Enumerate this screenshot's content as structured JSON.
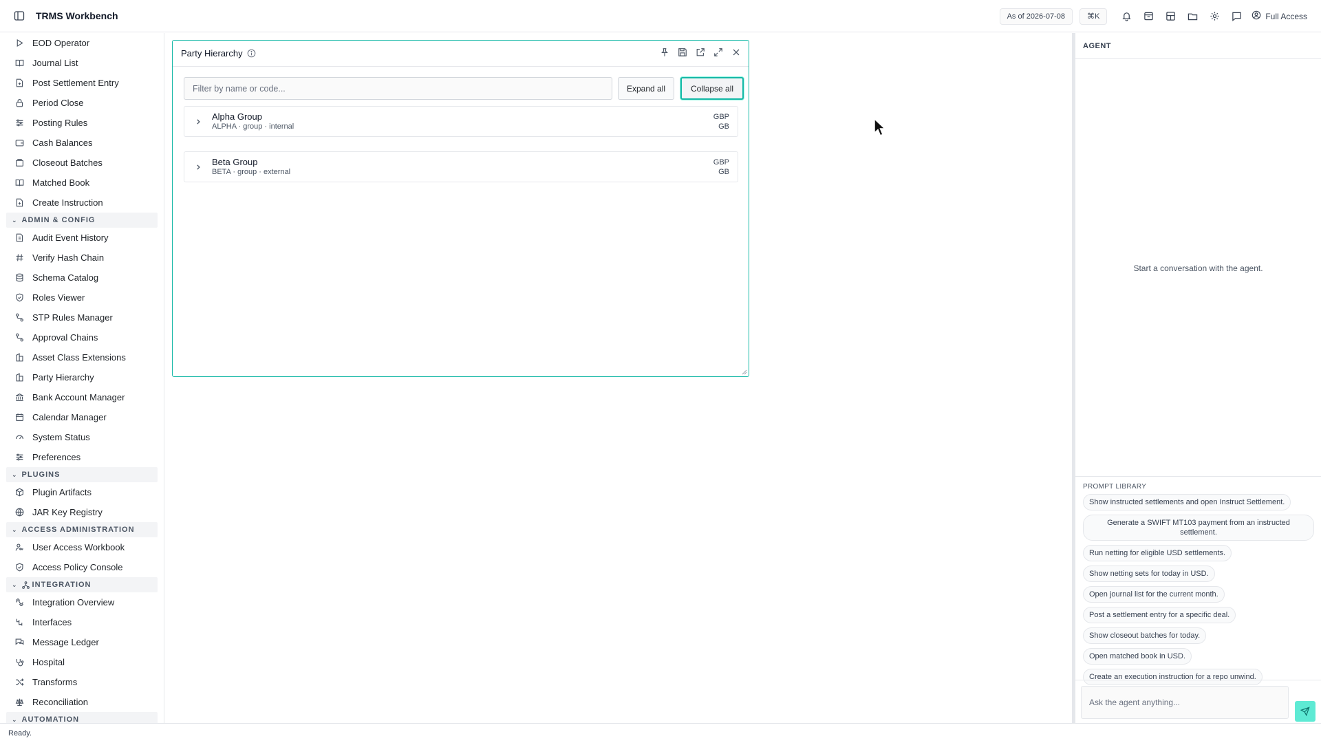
{
  "app": {
    "title": "TRMS Workbench"
  },
  "topbar": {
    "as_of": "As of 2026-07-08",
    "shortcut": "⌘K",
    "access_label": "Full Access",
    "icons": [
      "bell-icon",
      "archive-icon",
      "layout-icon",
      "folder-icon",
      "gear-icon",
      "chat-icon",
      "user-circle-icon"
    ]
  },
  "sidebar": {
    "items_top": [
      {
        "label": "EOD Operator",
        "icon": "play-icon"
      },
      {
        "label": "Journal List",
        "icon": "book-icon"
      },
      {
        "label": "Post Settlement Entry",
        "icon": "document-plus-icon"
      },
      {
        "label": "Period Close",
        "icon": "lock-icon"
      },
      {
        "label": "Posting Rules",
        "icon": "sliders-icon"
      },
      {
        "label": "Cash Balances",
        "icon": "wallet-icon"
      },
      {
        "label": "Closeout Batches",
        "icon": "batch-icon"
      },
      {
        "label": "Matched Book",
        "icon": "book-icon"
      },
      {
        "label": "Create Instruction",
        "icon": "document-plus-icon"
      }
    ],
    "admin_section": {
      "label": "ADMIN & CONFIG"
    },
    "items_admin": [
      {
        "label": "Audit Event History",
        "icon": "history-icon"
      },
      {
        "label": "Verify Hash Chain",
        "icon": "hash-icon"
      },
      {
        "label": "Schema Catalog",
        "icon": "database-icon"
      },
      {
        "label": "Roles Viewer",
        "icon": "shield-icon"
      },
      {
        "label": "STP Rules Manager",
        "icon": "route-icon"
      },
      {
        "label": "Approval Chains",
        "icon": "route-icon"
      },
      {
        "label": "Asset Class Extensions",
        "icon": "building-icon"
      },
      {
        "label": "Party Hierarchy",
        "icon": "building-icon"
      },
      {
        "label": "Bank Account Manager",
        "icon": "bank-icon"
      },
      {
        "label": "Calendar Manager",
        "icon": "calendar-icon"
      },
      {
        "label": "System Status",
        "icon": "gauge-icon"
      },
      {
        "label": "Preferences",
        "icon": "sliders-icon"
      }
    ],
    "plugins_section": {
      "label": "PLUGINS"
    },
    "items_plugins": [
      {
        "label": "Plugin Artifacts",
        "icon": "package-icon"
      },
      {
        "label": "JAR Key Registry",
        "icon": "globe-icon"
      }
    ],
    "access_section": {
      "label": "ACCESS ADMINISTRATION"
    },
    "items_access": [
      {
        "label": "User Access Workbook",
        "icon": "user-key-icon"
      },
      {
        "label": "Access Policy Console",
        "icon": "shield-icon"
      }
    ],
    "integration_section": {
      "label": "INTEGRATION"
    },
    "items_integration": [
      {
        "label": "Integration Overview",
        "icon": "integration-icon"
      },
      {
        "label": "Interfaces",
        "icon": "interfaces-icon"
      },
      {
        "label": "Message Ledger",
        "icon": "messages-icon"
      },
      {
        "label": "Hospital",
        "icon": "hospital-icon"
      },
      {
        "label": "Transforms",
        "icon": "shuffle-icon"
      },
      {
        "label": "Reconciliation",
        "icon": "scale-icon"
      }
    ],
    "automation_section": {
      "label": "AUTOMATION"
    }
  },
  "panel": {
    "title": "Party Hierarchy",
    "filter_placeholder": "Filter by name or code...",
    "filter_value": "",
    "expand_all": "Expand all",
    "collapse_all": "Collapse all",
    "parties": [
      {
        "name": "Alpha Group",
        "meta": "ALPHA · group · internal",
        "currency": "GBP",
        "country": "GB"
      },
      {
        "name": "Beta Group",
        "meta": "BETA · group · external",
        "currency": "GBP",
        "country": "GB"
      }
    ]
  },
  "agent": {
    "title": "AGENT",
    "empty_message": "Start a conversation with the agent.",
    "prompt_library_title": "PROMPT LIBRARY",
    "prompts": [
      "Show instructed settlements and open Instruct Settlement.",
      "Generate a SWIFT MT103 payment from an instructed settlement.",
      "Run netting for eligible USD settlements.",
      "Show netting sets for today in USD.",
      "Open journal list for the current month.",
      "Post a settlement entry for a specific deal.",
      "Show closeout batches for today.",
      "Open matched book in USD.",
      "Create an execution instruction for a repo unwind."
    ],
    "input_placeholder": "Ask the agent anything..."
  },
  "status": {
    "text": "Ready."
  },
  "colors": {
    "accent": "#14b8a6",
    "send_button": "#5eead4"
  }
}
